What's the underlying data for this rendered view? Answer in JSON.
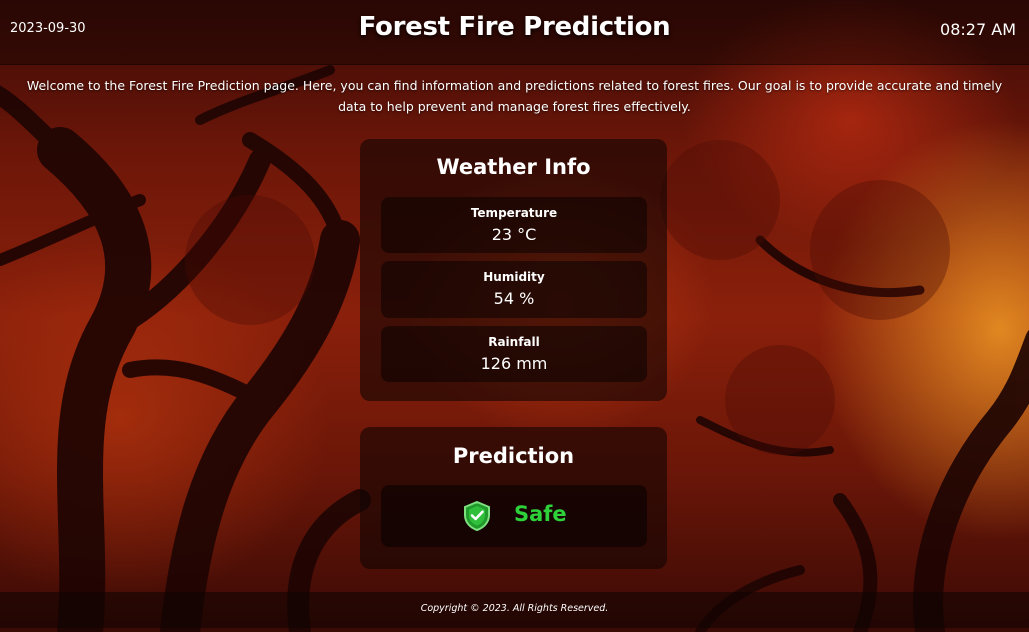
{
  "header": {
    "date": "2023-09-30",
    "title": "Forest Fire Prediction",
    "time": "08:27 AM"
  },
  "welcome_text": "Welcome to the Forest Fire Prediction page. Here, you can find information and predictions related to forest fires. Our goal is to provide accurate and timely data to help prevent and manage forest fires effectively.",
  "weather": {
    "heading": "Weather Info",
    "temperature": {
      "label": "Temperature",
      "value": "23 °C"
    },
    "humidity": {
      "label": "Humidity",
      "value": "54 %"
    },
    "rainfall": {
      "label": "Rainfall",
      "value": "126 mm"
    }
  },
  "prediction": {
    "heading": "Prediction",
    "value": "Safe",
    "icon": "shield-check-icon",
    "status_color": "#2fd13a"
  },
  "footer": {
    "text": "Copyright © 2023. All Rights Reserved."
  }
}
